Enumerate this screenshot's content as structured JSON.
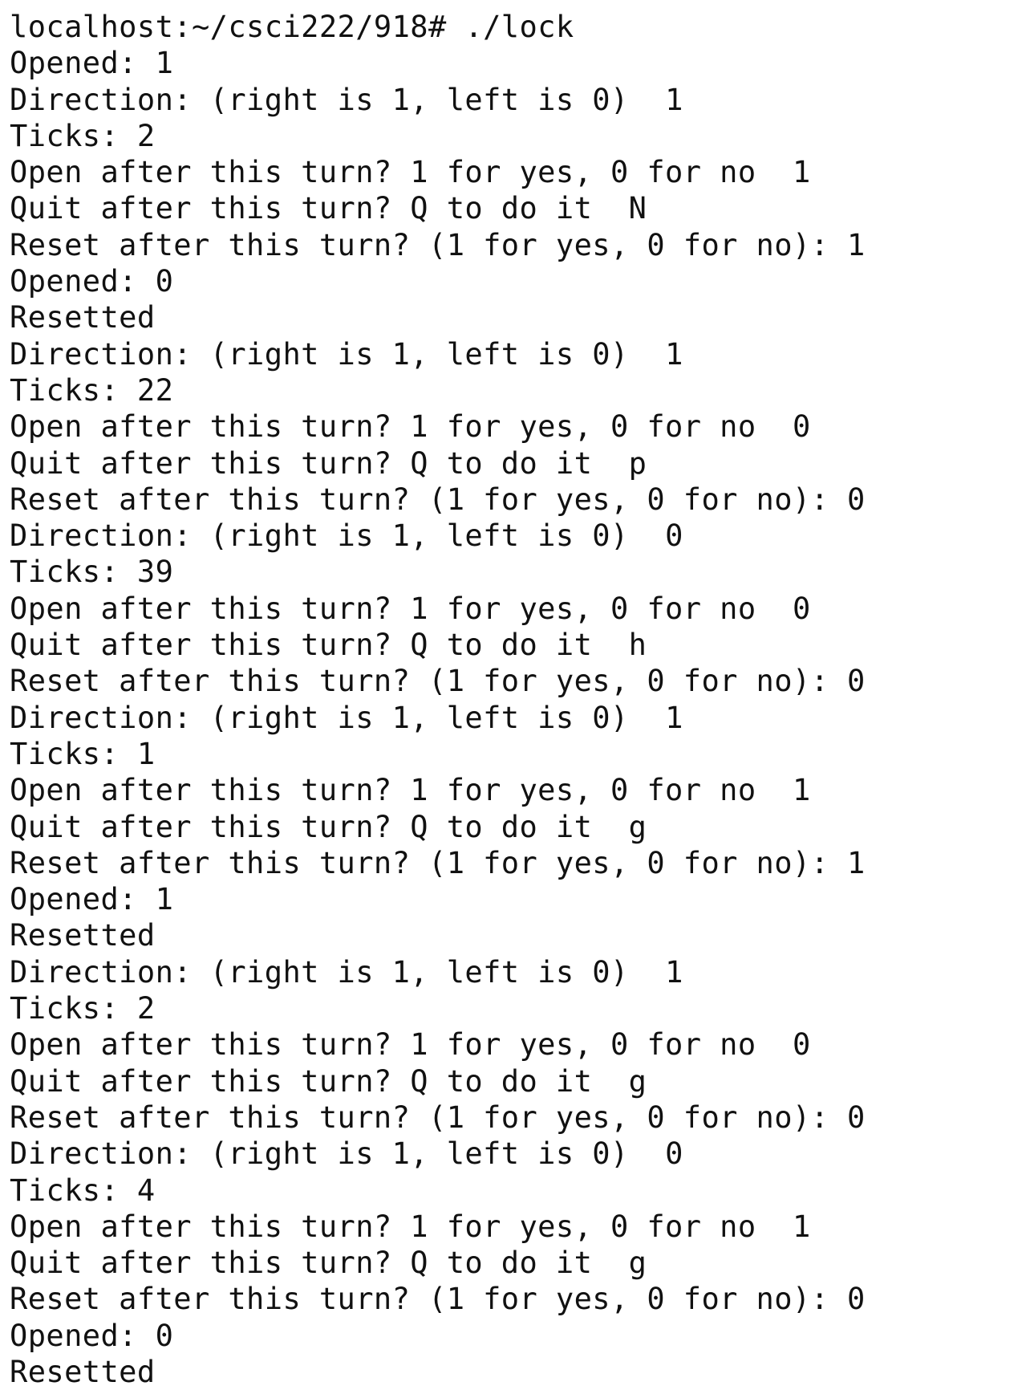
{
  "terminal": {
    "text_color": "#111111",
    "background_color": "#ffffff",
    "prompt": {
      "host_path": "localhost:~/csci222/918#",
      "command": "./lock"
    },
    "lines": [
      {
        "label": "Opened: ",
        "value": "1"
      },
      {
        "label": "Direction: (right is 1, left is 0)  ",
        "value": "1"
      },
      {
        "label": "Ticks: ",
        "value": "2"
      },
      {
        "label": "Open after this turn? 1 for yes, 0 for no  ",
        "value": "1"
      },
      {
        "label": "Quit after this turn? Q to do it  ",
        "value": "N"
      },
      {
        "label": "Reset after this turn? (1 for yes, 0 for no): ",
        "value": "1"
      },
      {
        "label": "Opened: ",
        "value": "0"
      },
      {
        "label": "Resetted",
        "value": ""
      },
      {
        "label": "Direction: (right is 1, left is 0)  ",
        "value": "1"
      },
      {
        "label": "Ticks: ",
        "value": "22"
      },
      {
        "label": "Open after this turn? 1 for yes, 0 for no  ",
        "value": "0"
      },
      {
        "label": "Quit after this turn? Q to do it  ",
        "value": "p"
      },
      {
        "label": "Reset after this turn? (1 for yes, 0 for no): ",
        "value": "0"
      },
      {
        "label": "Direction: (right is 1, left is 0)  ",
        "value": "0"
      },
      {
        "label": "Ticks: ",
        "value": "39"
      },
      {
        "label": "Open after this turn? 1 for yes, 0 for no  ",
        "value": "0"
      },
      {
        "label": "Quit after this turn? Q to do it  ",
        "value": "h"
      },
      {
        "label": "Reset after this turn? (1 for yes, 0 for no): ",
        "value": "0"
      },
      {
        "label": "Direction: (right is 1, left is 0)  ",
        "value": "1"
      },
      {
        "label": "Ticks: ",
        "value": "1"
      },
      {
        "label": "Open after this turn? 1 for yes, 0 for no  ",
        "value": "1"
      },
      {
        "label": "Quit after this turn? Q to do it  ",
        "value": "g"
      },
      {
        "label": "Reset after this turn? (1 for yes, 0 for no): ",
        "value": "1"
      },
      {
        "label": "Opened: ",
        "value": "1"
      },
      {
        "label": "Resetted",
        "value": ""
      },
      {
        "label": "Direction: (right is 1, left is 0)  ",
        "value": "1"
      },
      {
        "label": "Ticks: ",
        "value": "2"
      },
      {
        "label": "Open after this turn? 1 for yes, 0 for no  ",
        "value": "0"
      },
      {
        "label": "Quit after this turn? Q to do it  ",
        "value": "g"
      },
      {
        "label": "Reset after this turn? (1 for yes, 0 for no): ",
        "value": "0"
      },
      {
        "label": "Direction: (right is 1, left is 0)  ",
        "value": "0"
      },
      {
        "label": "Ticks: ",
        "value": "4"
      },
      {
        "label": "Open after this turn? 1 for yes, 0 for no  ",
        "value": "1"
      },
      {
        "label": "Quit after this turn? Q to do it  ",
        "value": "g"
      },
      {
        "label": "Reset after this turn? (1 for yes, 0 for no): ",
        "value": "0"
      },
      {
        "label": "Opened: ",
        "value": "0"
      },
      {
        "label": "Resetted",
        "value": ""
      }
    ]
  }
}
